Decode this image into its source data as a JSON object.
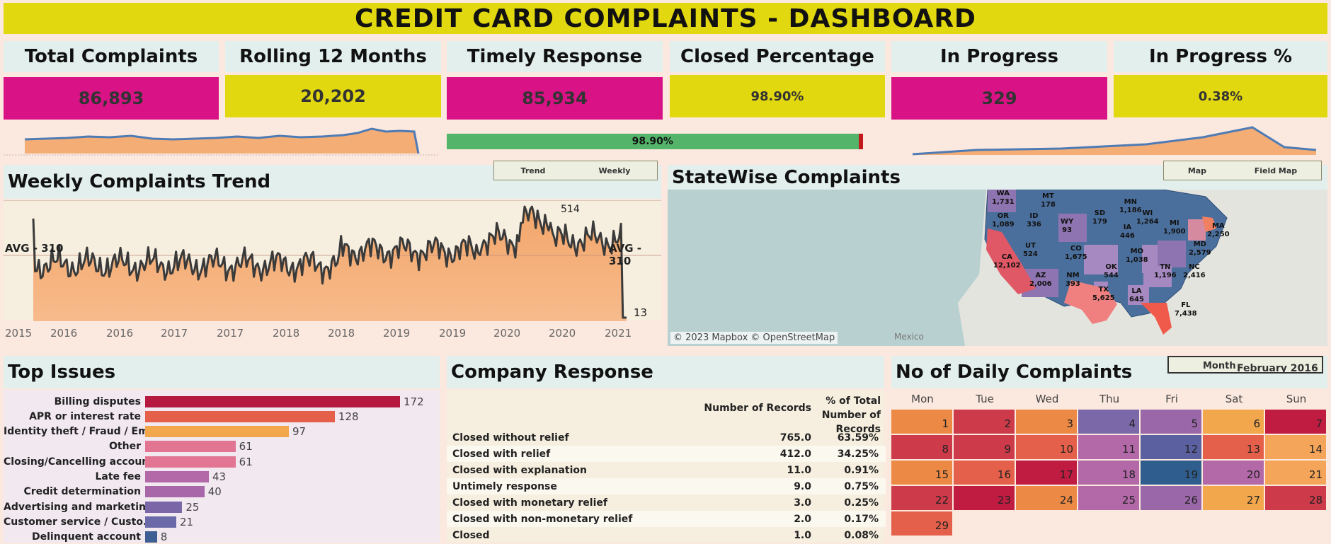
{
  "title": "CREDIT CARD COMPLAINTS - DASHBOARD",
  "kpis": [
    {
      "label": "Total Complaints",
      "value": "86,893"
    },
    {
      "label": "Rolling 12 Months",
      "value": "20,202"
    },
    {
      "label": "Timely Response",
      "value": "85,934"
    },
    {
      "label": "Closed Percentage",
      "value": "98.90%"
    },
    {
      "label": "In Progress",
      "value": "329"
    },
    {
      "label": "In Progress %",
      "value": "0.38%"
    }
  ],
  "closed_bar": {
    "label": "98.90%",
    "fraction": 0.989
  },
  "weekly": {
    "title": "Weekly Complaints Trend",
    "toggle": {
      "left": "Trend",
      "right": "Weekly"
    },
    "avg_left": "AVG - 310",
    "avg_right": "AVG - 310",
    "peak_label": "514",
    "last_label": "13",
    "x_ticks": [
      "2015",
      "2016",
      "2016",
      "2017",
      "2017",
      "2018",
      "2018",
      "2019",
      "2019",
      "2020",
      "2020",
      "2021"
    ]
  },
  "map": {
    "title": "StateWise Complaints",
    "toggle": {
      "left": "Map",
      "right": "Field Map"
    },
    "attribution": "© 2023 Mapbox © OpenStreetMap",
    "country_label": "Mexico",
    "states": [
      {
        "abbr": "WA",
        "value": "1,731"
      },
      {
        "abbr": "MT",
        "value": "178"
      },
      {
        "abbr": "MN",
        "value": "1,186"
      },
      {
        "abbr": "OR",
        "value": "1,089"
      },
      {
        "abbr": "ID",
        "value": "336"
      },
      {
        "abbr": "SD",
        "value": "179"
      },
      {
        "abbr": "WI",
        "value": "1,264"
      },
      {
        "abbr": "MI",
        "value": "1,900"
      },
      {
        "abbr": "WY",
        "value": "93"
      },
      {
        "abbr": "IA",
        "value": "446"
      },
      {
        "abbr": "MA",
        "value": "2,250"
      },
      {
        "abbr": "UT",
        "value": "524"
      },
      {
        "abbr": "CO",
        "value": "1,675"
      },
      {
        "abbr": "MO",
        "value": "1,038"
      },
      {
        "abbr": "MD",
        "value": "2,579"
      },
      {
        "abbr": "CA",
        "value": "12,102"
      },
      {
        "abbr": "OK",
        "value": "544"
      },
      {
        "abbr": "TN",
        "value": "1,196"
      },
      {
        "abbr": "NC",
        "value": "2,416"
      },
      {
        "abbr": "AZ",
        "value": "2,006"
      },
      {
        "abbr": "NM",
        "value": "393"
      },
      {
        "abbr": "TX",
        "value": "5,625"
      },
      {
        "abbr": "LA",
        "value": "645"
      },
      {
        "abbr": "FL",
        "value": "7,438"
      }
    ]
  },
  "top_issues": {
    "title": "Top Issues",
    "items": [
      {
        "label": "Billing disputes",
        "value": 172,
        "color": "#b5193f"
      },
      {
        "label": "APR or interest rate",
        "value": 128,
        "color": "#e4604a"
      },
      {
        "label": "Identity theft / Fraud / Em..",
        "value": 97,
        "color": "#f2a74c"
      },
      {
        "label": "Other",
        "value": 61,
        "color": "#e27592"
      },
      {
        "label": "Closing/Cancelling account",
        "value": 61,
        "color": "#e27592"
      },
      {
        "label": "Late fee",
        "value": 43,
        "color": "#b368a8"
      },
      {
        "label": "Credit determination",
        "value": 40,
        "color": "#a767a8"
      },
      {
        "label": "Advertising and marketing",
        "value": 25,
        "color": "#7b67a8"
      },
      {
        "label": "Customer service / Custo..",
        "value": 21,
        "color": "#6a6aa8"
      },
      {
        "label": "Delinquent account",
        "value": 8,
        "color": "#3d5f94"
      }
    ]
  },
  "company_response": {
    "title": "Company Response",
    "col2": "Number of Records",
    "col3": "% of Total Number of Records",
    "rows": [
      {
        "label": "Closed without relief",
        "records": "765.0",
        "pct": "63.59%"
      },
      {
        "label": "Closed with relief",
        "records": "412.0",
        "pct": "34.25%"
      },
      {
        "label": "Closed with explanation",
        "records": "11.0",
        "pct": "0.91%"
      },
      {
        "label": "Untimely response",
        "records": "9.0",
        "pct": "0.75%"
      },
      {
        "label": "Closed with monetary relief",
        "records": "3.0",
        "pct": "0.25%"
      },
      {
        "label": "Closed with non-monetary relief",
        "records": "2.0",
        "pct": "0.17%"
      },
      {
        "label": "Closed",
        "records": "1.0",
        "pct": "0.08%"
      }
    ]
  },
  "calendar": {
    "title": "No of Daily Complaints",
    "month_label": "Month",
    "month_value": "February 2016",
    "days": [
      "Mon",
      "Tue",
      "Wed",
      "Thu",
      "Fri",
      "Sat",
      "Sun"
    ],
    "cells": [
      {
        "day": "1",
        "color": "#ec8a45"
      },
      {
        "day": "2",
        "color": "#cd3a4a"
      },
      {
        "day": "3",
        "color": "#ec8a45"
      },
      {
        "day": "4",
        "color": "#7a68a8"
      },
      {
        "day": "5",
        "color": "#9a67a8"
      },
      {
        "day": "6",
        "color": "#f2a74c"
      },
      {
        "day": "7",
        "color": "#c01c42"
      },
      {
        "day": "8",
        "color": "#cd3a4a"
      },
      {
        "day": "9",
        "color": "#cd3a4a"
      },
      {
        "day": "10",
        "color": "#e4604a"
      },
      {
        "day": "11",
        "color": "#b368a8"
      },
      {
        "day": "12",
        "color": "#5a60a0"
      },
      {
        "day": "13",
        "color": "#e4604a"
      },
      {
        "day": "14",
        "color": "#f5a55a"
      },
      {
        "day": "15",
        "color": "#ec8a45"
      },
      {
        "day": "16",
        "color": "#e4604a"
      },
      {
        "day": "17",
        "color": "#c01c42"
      },
      {
        "day": "18",
        "color": "#b368a8"
      },
      {
        "day": "19",
        "color": "#2f5e8e"
      },
      {
        "day": "20",
        "color": "#b368a8"
      },
      {
        "day": "21",
        "color": "#f5a55a"
      },
      {
        "day": "22",
        "color": "#cd3a4a"
      },
      {
        "day": "23",
        "color": "#c01c42"
      },
      {
        "day": "24",
        "color": "#ec8a45"
      },
      {
        "day": "25",
        "color": "#b368a8"
      },
      {
        "day": "26",
        "color": "#9a67a8"
      },
      {
        "day": "27",
        "color": "#f2a74c"
      },
      {
        "day": "28",
        "color": "#cd3a4a"
      },
      {
        "day": "29",
        "color": "#e4604a"
      }
    ]
  }
}
